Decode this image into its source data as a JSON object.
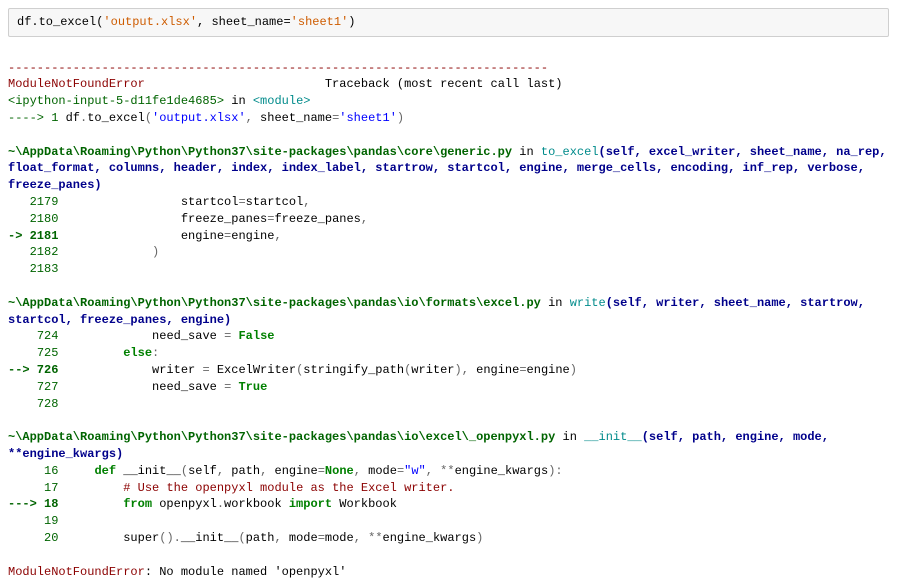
{
  "input": {
    "code_plain": "df.to_excel(",
    "str1": "'output.xlsx'",
    "sep": ", sheet_name=",
    "str2": "'sheet1'",
    "close": ")"
  },
  "dashes": "---------------------------------------------------------------------------",
  "err_name": "ModuleNotFoundError",
  "tb_label": "Traceback (most recent call last)",
  "frame0": {
    "loc": "<ipython-input-5-d11fe1de4685>",
    "in": " in ",
    "mod": "<module>",
    "arrow": "----> 1 ",
    "code_a": "df",
    "dot1": ".",
    "code_b": "to_excel",
    "open": "(",
    "s1": "'output.xlsx'",
    "comma": ",",
    "kw": " sheet_name",
    "eq": "=",
    "s2": "'sheet1'",
    "close": ")"
  },
  "frame1": {
    "path": "~\\AppData\\Roaming\\Python\\Python37\\site-packages\\pandas\\core\\generic.py",
    "in": " in ",
    "fn": "to_excel",
    "sig": "(self, excel_writer, sheet_name, na_rep, float_format, columns, header, index, index_label, startrow, startcol, engine, merge_cells, encoding, inf_rep, verbose, freeze_panes)",
    "l2179": "   2179 ",
    "c2179": "                startcol",
    "eq": "=",
    "v2179": "startcol",
    "comma": ",",
    "l2180": "   2180 ",
    "c2180": "                freeze_panes",
    "v2180": "freeze_panes",
    "l2181a": "-> 2181 ",
    "c2181": "                engine",
    "v2181": "engine",
    "l2182": "   2182 ",
    "c2182": "            )",
    "l2183": "   2183 "
  },
  "frame2": {
    "path": "~\\AppData\\Roaming\\Python\\Python37\\site-packages\\pandas\\io\\formats\\excel.py",
    "in": " in ",
    "fn": "write",
    "sig": "(self, writer, sheet_name, startrow, startcol, freeze_panes, engine)",
    "l724": "    724 ",
    "c724": "            need_save ",
    "eq": "=",
    "false": " False",
    "l725": "    725 ",
    "c725": "        ",
    "else": "else",
    "colon": ":",
    "l726a": "--> 726 ",
    "c726a": "            writer ",
    "c726b": " ExcelWriter",
    "open": "(",
    "c726c": "stringify_path",
    "c726d": "writer",
    "close": ")",
    "comma": ",",
    "c726e": " engine",
    "c726f": "engine",
    "l727": "    727 ",
    "c727": "            need_save ",
    "true": " True",
    "l728": "    728 "
  },
  "frame3": {
    "path": "~\\AppData\\Roaming\\Python\\Python37\\site-packages\\pandas\\io\\excel\\_openpyxl.py",
    "in": " in ",
    "fn": "__init__",
    "sig": "(self, path, engine, mode, **engine_kwargs)",
    "l16": "     16 ",
    "c16a": "    ",
    "def": "def",
    "c16b": " __init__",
    "open": "(",
    "c16c": "self",
    "comma": ",",
    "c16d": " path",
    "c16e": " engine",
    "eq": "=",
    "none": "None",
    "c16f": " mode",
    "modew": "\"w\"",
    "c16g": " ",
    "starstar": "**",
    "c16h": "engine_kwargs",
    "close": ")",
    "colon": ":",
    "l17": "     17 ",
    "c17": "        # Use the openpyxl module as the Excel writer.",
    "l18a": "---> 18 ",
    "c18a": "        ",
    "from": "from",
    "c18b": " openpyxl",
    "dot": ".",
    "c18c": "workbook ",
    "import": "import",
    "c18d": " Workbook",
    "l19": "     19 ",
    "l20": "     20 ",
    "c20a": "        super",
    "c20b": "()",
    "c20c": "__init__",
    "c20d": "path",
    "c20e": " mode",
    "c20f": "mode",
    "c20g": "engine_kwargs"
  },
  "final_err": "ModuleNotFoundError",
  "final_msg": ": No module named 'openpyxl'"
}
